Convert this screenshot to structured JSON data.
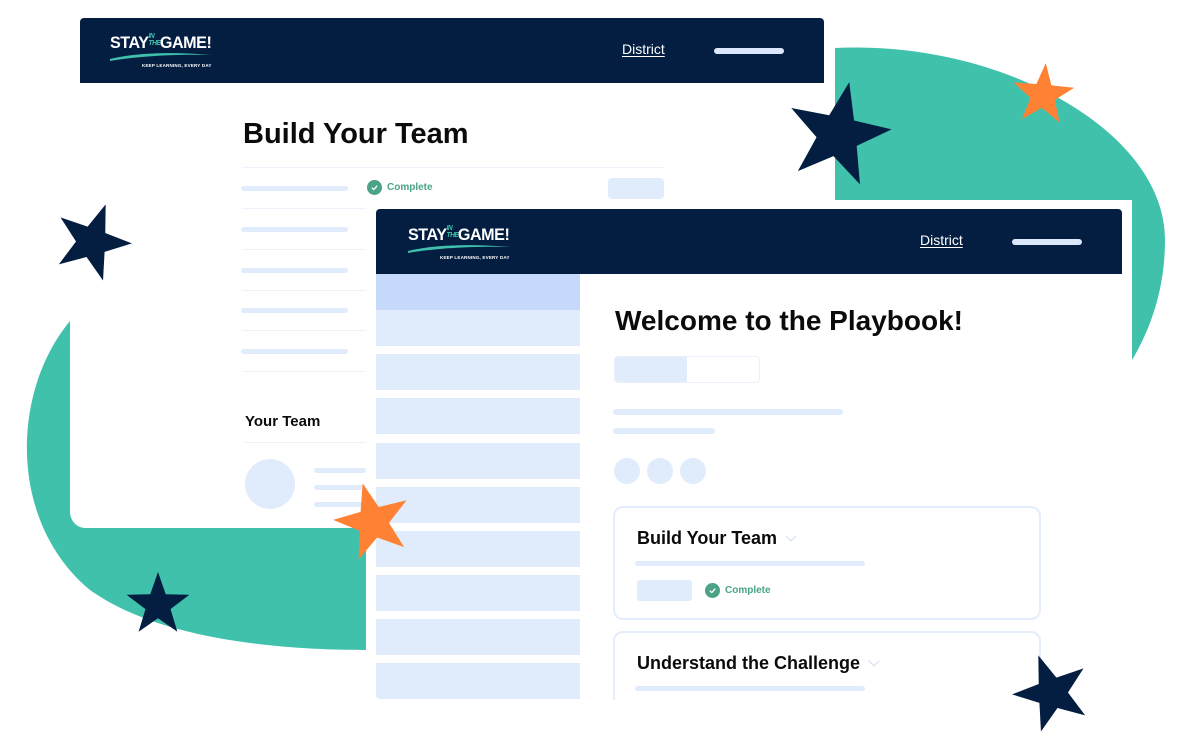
{
  "colors": {
    "navy": "#041e42",
    "teal": "#40c1ac",
    "orange": "#ff8133",
    "placeholder_blue": "#e0ecfb",
    "active_blue": "#c5dafa",
    "complete_green": "#4aa387"
  },
  "brand": {
    "wordmark_left": "STAY",
    "wordmark_mid": "IN THE",
    "wordmark_right": "GAME!",
    "tagline": "KEEP LEARNING, EVERY DAY"
  },
  "back_window": {
    "nav_link": "District",
    "page_title": "Build Your Team",
    "status_label": "Complete",
    "section_title": "Your Team"
  },
  "front_window": {
    "nav_link": "District",
    "page_title": "Welcome to the Playbook!",
    "progress_fraction": 0.5,
    "sidebar_items": 10,
    "sidebar_active_index": 0,
    "cards": [
      {
        "title": "Build Your Team",
        "status_label": "Complete"
      },
      {
        "title": "Understand the Challenge"
      }
    ]
  },
  "decor": {
    "stars": [
      "navy-star",
      "orange-star",
      "navy-star",
      "orange-star",
      "navy-star",
      "navy-star"
    ]
  }
}
